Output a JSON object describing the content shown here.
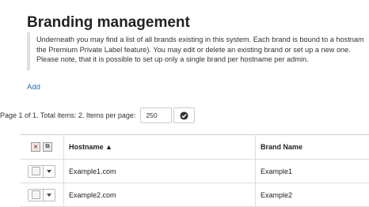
{
  "page": {
    "title": "Branding management"
  },
  "info": {
    "lines": [
      "Underneath you may find a list of all brands existing in this system. Each brand is bound to a hostnam",
      "the Premium Private Label feature). You may edit or delete an existing brand or set up a new one.",
      "Please note, that it is possible to set up only a single brand per hostname per admin."
    ]
  },
  "actions": {
    "add_label": "Add"
  },
  "pager": {
    "summary": "Page 1 of 1. Total items: 2. Items per page:",
    "per_page_value": "250",
    "apply_icon": "check-circle-icon"
  },
  "table": {
    "header_icons": [
      "delete-selected-icon",
      "copy-selected-icon"
    ],
    "columns": [
      "Hostname ▲",
      "Brand Name"
    ],
    "rows": [
      {
        "hostname": "Example1.com",
        "brand_name": "Example1"
      },
      {
        "hostname": "Example2.com",
        "brand_name": "Example2"
      }
    ]
  }
}
